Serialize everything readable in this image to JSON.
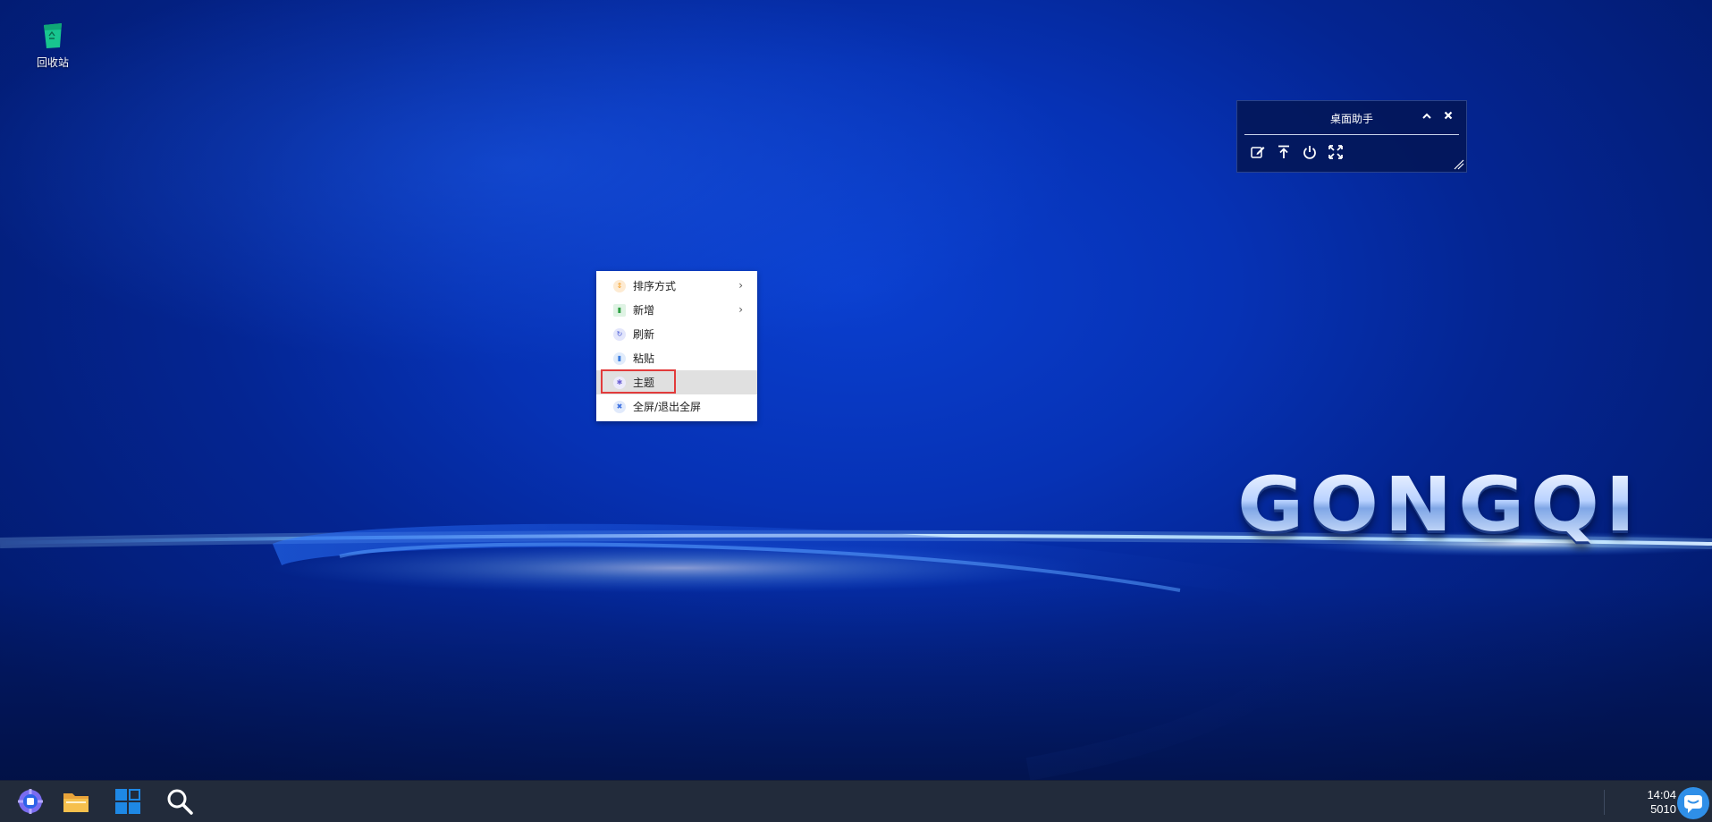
{
  "desktop": {
    "icons": [
      {
        "label": "回收站",
        "icon": "recycle-bin-icon"
      }
    ],
    "logo_text": "GONGQI",
    "background_color": "#0632b5"
  },
  "helper_widget": {
    "title": "桌面助手",
    "collapse_icon": "chevron-up-icon",
    "close_icon": "close-icon",
    "tools": [
      {
        "name": "edit",
        "icon": "edit-icon"
      },
      {
        "name": "pin-top",
        "icon": "arrow-to-top-icon"
      },
      {
        "name": "power",
        "icon": "power-icon"
      },
      {
        "name": "fullscreen",
        "icon": "expand-icon"
      }
    ]
  },
  "context_menu": {
    "items": [
      {
        "label": "排序方式",
        "icon": "sort-icon",
        "submenu": true,
        "color": "#f29b1d"
      },
      {
        "label": "新增",
        "icon": "new-file-icon",
        "submenu": true,
        "color": "#2ea043"
      },
      {
        "label": "刷新",
        "icon": "refresh-icon",
        "submenu": false,
        "color": "#4a5bd6"
      },
      {
        "label": "粘贴",
        "icon": "paste-icon",
        "submenu": false,
        "color": "#3b7de0"
      },
      {
        "label": "主题",
        "icon": "theme-icon",
        "submenu": false,
        "color": "#6b5fd3",
        "highlighted": true
      },
      {
        "label": "全屏/退出全屏",
        "icon": "fullscreen-icon",
        "submenu": false,
        "color": "#3b6fe0"
      }
    ],
    "highlight_color": "#e23b3b"
  },
  "taskbar": {
    "buttons": [
      {
        "name": "start",
        "icon": "start-menu-icon"
      },
      {
        "name": "file-explorer",
        "icon": "folder-icon"
      },
      {
        "name": "app-grid",
        "icon": "windows-grid-icon"
      },
      {
        "name": "search",
        "icon": "search-icon"
      }
    ],
    "clock": {
      "time": "14:04",
      "date": "5010"
    },
    "tray_icon": "chat-icon"
  }
}
